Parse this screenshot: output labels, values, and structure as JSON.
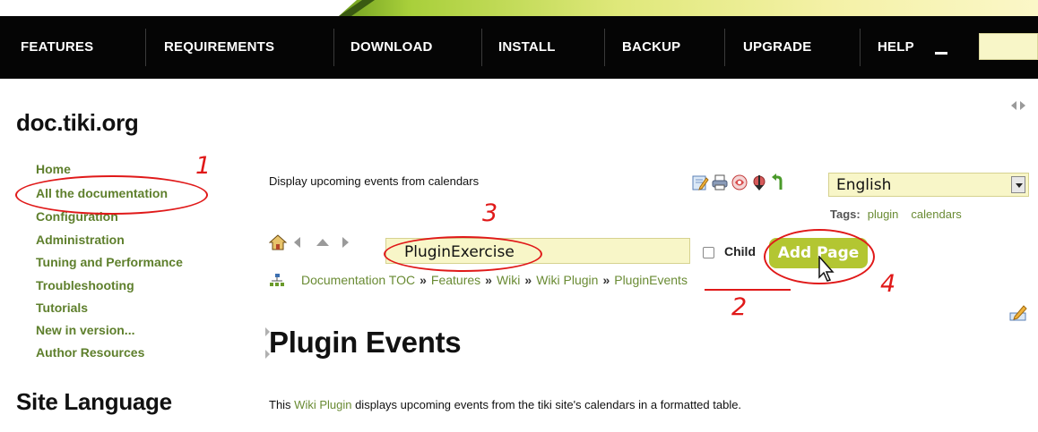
{
  "nav": {
    "items": [
      "FEATURES",
      "REQUIREMENTS",
      "DOWNLOAD",
      "INSTALL",
      "BACKUP",
      "UPGRADE",
      "HELP"
    ]
  },
  "site": {
    "title": "doc.tiki.org"
  },
  "menu": {
    "items": [
      "Home",
      "All the documentation",
      "Configuration",
      "Administration",
      "Tuning and Performance",
      "Troubleshooting",
      "Tutorials",
      "New in version...",
      "Author Resources"
    ]
  },
  "site_language": "Site Language",
  "page": {
    "description": "Display upcoming events from calendars",
    "language": "English",
    "tags_label": "Tags:",
    "tags": [
      "plugin",
      "calendars"
    ],
    "new_page_value": "PluginExercise",
    "child_label": "Child",
    "add_page_label": "Add Page",
    "breadcrumb": [
      "Documentation TOC",
      "Features",
      "Wiki",
      "Wiki Plugin",
      "PluginEvents"
    ],
    "breadcrumb_sep": "»",
    "heading": "Plugin Events",
    "body_before": "This ",
    "body_link": "Wiki Plugin",
    "body_after": " displays upcoming events from the tiki site's calendars in a formatted table."
  },
  "annotations": [
    "1",
    "2",
    "3",
    "4"
  ],
  "icons": [
    "edit-icon",
    "print-icon",
    "pdf-icon",
    "export-icon",
    "undo-icon",
    "home-icon",
    "back-icon",
    "up-icon",
    "forward-icon",
    "structure-tree-icon",
    "collapse-icon",
    "mouse-cursor-icon"
  ],
  "colors": {
    "nav_bg": "#050505",
    "link_green": "#6a8b34",
    "button_green": "#b3c632",
    "annotation_red": "#e01919",
    "input_bg": "#f8f6c8"
  }
}
